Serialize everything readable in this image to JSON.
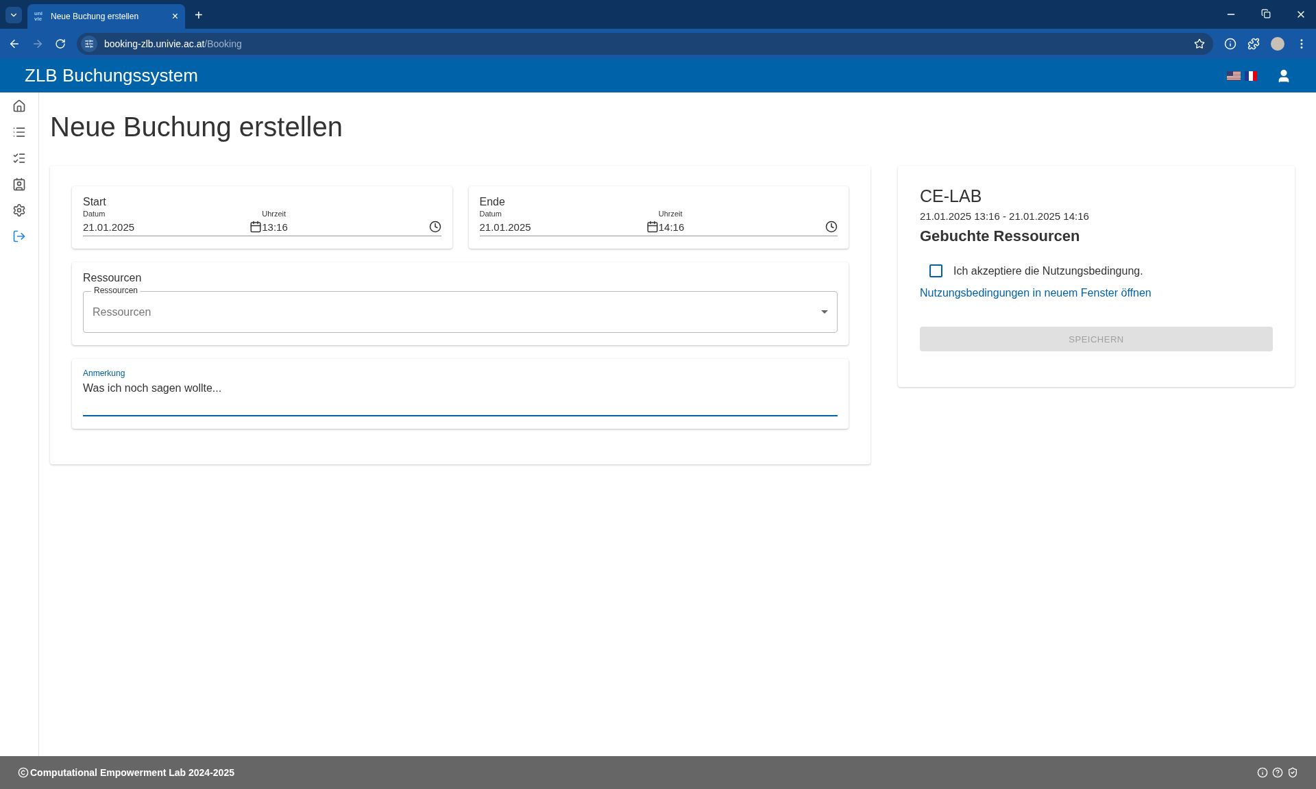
{
  "browser": {
    "tab": {
      "favicon": "uni vie",
      "title": "Neue Buchung erstellen",
      "close": "×"
    },
    "new_tab": "+",
    "url_host": "booking-zlb.univie.ac.at",
    "url_path": "/Booking"
  },
  "app": {
    "title": "ZLB Buchungssystem"
  },
  "sidebar": {
    "items": [
      {
        "kind": "home",
        "selected": false
      },
      {
        "kind": "list",
        "selected": false
      },
      {
        "kind": "checklist",
        "selected": false
      },
      {
        "kind": "contact",
        "selected": false
      },
      {
        "kind": "settings",
        "selected": false
      },
      {
        "kind": "logout",
        "selected": true
      }
    ]
  },
  "page_title": "Neue Buchung erstellen",
  "times": [
    {
      "title": "Start",
      "date_label": "Datum",
      "date": "21.01.2025",
      "time_label": "Uhrzeit",
      "time": "13:16"
    },
    {
      "title": "Ende",
      "date_label": "Datum",
      "date": "21.01.2025",
      "time_label": "Uhrzeit",
      "time": "14:16"
    }
  ],
  "resources": {
    "title": "Ressourcen",
    "label": "Ressourcen",
    "placeholder": "Ressourcen"
  },
  "note": {
    "label": "Anmerkung",
    "value": "Was ich noch sagen wollte..."
  },
  "summary": {
    "title": "CE-LAB",
    "range": "21.01.2025 13:16 - 21.01.2025 14:16",
    "heading": "Gebuchte Ressourcen",
    "accept": {
      "label": "Ich akzeptiere die Nutzungsbedingung.",
      "checked": false
    },
    "link": "Nutzungsbedingungen in neuem Fenster öffnen",
    "save": {
      "label": "SPEICHERN",
      "disabled": true
    }
  },
  "footer": {
    "text": "Computational Empowerment Lab 2024-2025"
  }
}
